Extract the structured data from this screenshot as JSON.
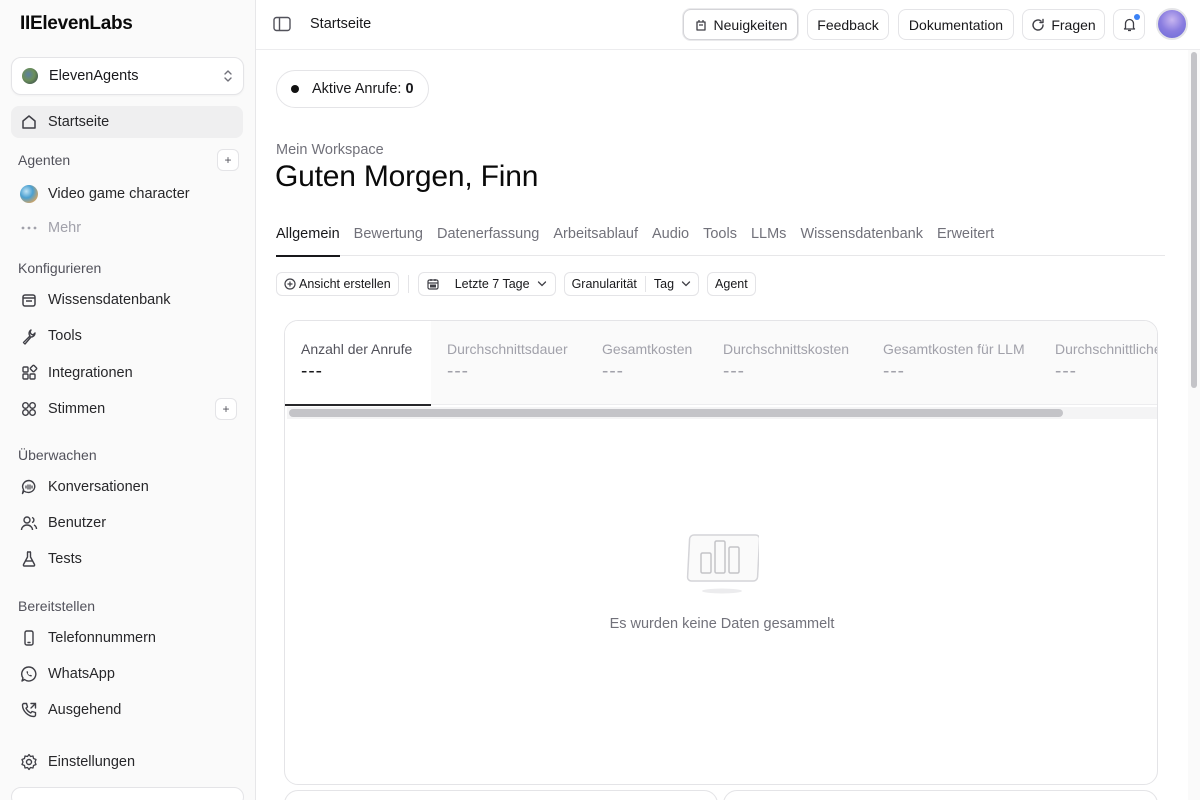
{
  "brand": {
    "logo_text": "IIElevenLabs"
  },
  "workspace_selector": {
    "label": "ElevenAgents"
  },
  "sidebar": {
    "home": "Startseite",
    "sections": {
      "agents": "Agenten",
      "configure": "Konfigurieren",
      "monitor": "Überwachen",
      "deploy": "Bereitstellen"
    },
    "agents": [
      {
        "label": "Video game character"
      }
    ],
    "more": "Mehr",
    "configure_items": [
      "Wissensdatenbank",
      "Tools",
      "Integrationen",
      "Stimmen"
    ],
    "monitor_items": [
      "Konversationen",
      "Benutzer",
      "Tests"
    ],
    "deploy_items": [
      "Telefonnummern",
      "WhatsApp",
      "Ausgehend"
    ],
    "settings": "Einstellungen"
  },
  "topbar": {
    "breadcrumb": "Startseite",
    "news": "Neuigkeiten",
    "feedback": "Feedback",
    "docs": "Dokumentation",
    "ask": "Fragen"
  },
  "main": {
    "active_calls_label": "Aktive Anrufe:",
    "active_calls_value": "0",
    "workspace_name": "Mein Workspace",
    "greeting": "Guten Morgen, Finn",
    "tabs": [
      "Allgemein",
      "Bewertung",
      "Datenerfassung",
      "Arbeitsablauf",
      "Audio",
      "Tools",
      "LLMs",
      "Wissensdatenbank",
      "Erweitert"
    ],
    "filters": {
      "create_view": "Ansicht erstellen",
      "date_range": "Letzte 7 Tage",
      "granularity_label": "Granularität",
      "granularity_value": "Tag",
      "agent": "Agent"
    },
    "metrics": [
      {
        "label": "Anzahl der Anrufe",
        "value": "---"
      },
      {
        "label": "Durchschnittsdauer",
        "value": "---"
      },
      {
        "label": "Gesamtkosten",
        "value": "---"
      },
      {
        "label": "Durchschnittskosten",
        "value": "---"
      },
      {
        "label": "Gesamtkosten für LLM",
        "value": "---"
      },
      {
        "label": "Durchschnittliche",
        "value": "---"
      }
    ],
    "empty_state": "Es wurden keine Daten gesammelt"
  }
}
